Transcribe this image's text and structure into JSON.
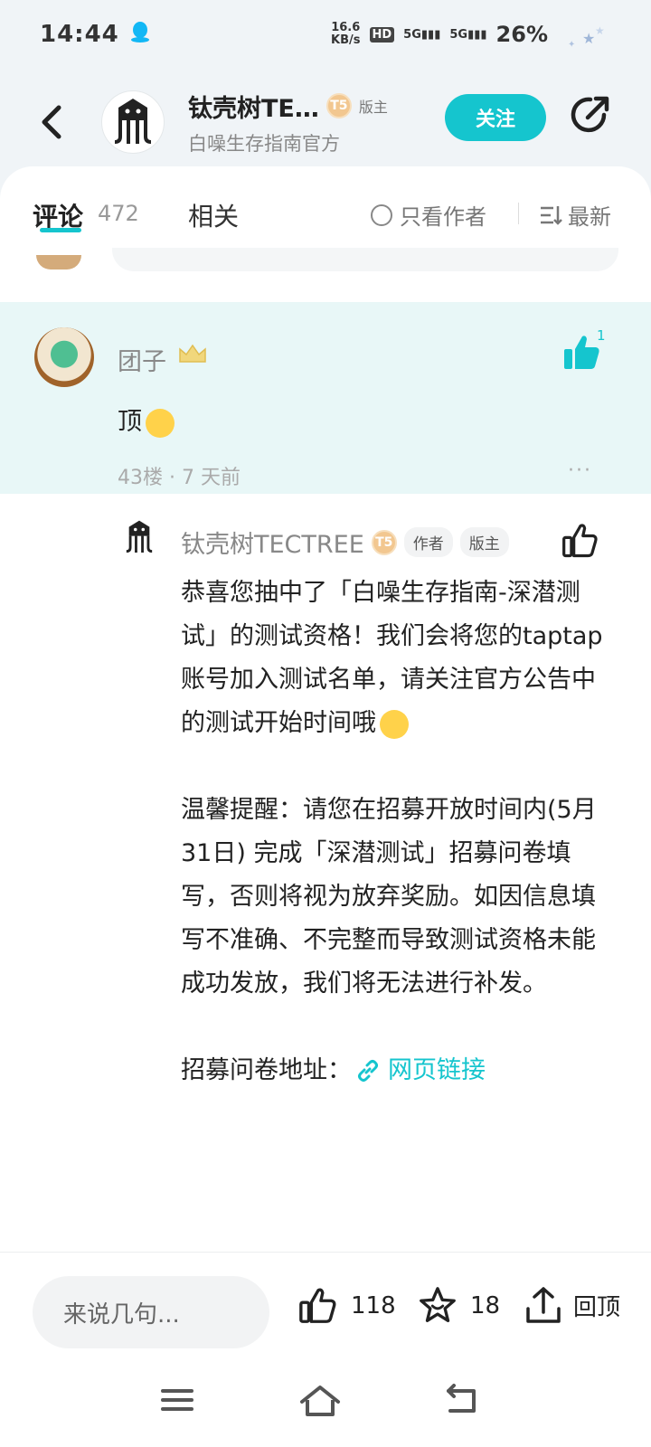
{
  "status_bar": {
    "time": "14:44",
    "speed_value": "16.6",
    "speed_unit": "KB/s",
    "hd_label": "HD",
    "signal1": "5G",
    "signal2": "5G",
    "battery": "26%",
    "icons": [
      "qq-icon",
      "signal-icon",
      "battery-icon"
    ]
  },
  "header": {
    "name": "钛壳树TE…",
    "level": "T5",
    "role": "版主",
    "subtitle": "白噪生存指南官方",
    "follow_label": "关注"
  },
  "tabs": {
    "comments_label": "评论",
    "comments_count": "472",
    "related_label": "相关",
    "author_only_label": "只看作者",
    "sort_label": "最新"
  },
  "comment": {
    "user": "团子",
    "text": "顶",
    "floor": "43楼",
    "time": "7 天前",
    "meta_sep": " · ",
    "like_count": "1",
    "more": "···"
  },
  "reply": {
    "user": "钛壳树TECTREE",
    "level": "T5",
    "tag_author": "作者",
    "tag_role": "版主",
    "para1": "恭喜您抽中了「白噪生存指南-深潜测试」的测试资格！我们会将您的taptap账号加入测试名单，请关注官方公告中的测试开始时间哦",
    "para2": "温馨提醒：请您在招募开放时间内(5月31日) 完成「深潜测试」招募问卷填写，否则将视为放弃奖励。如因信息填写不准确、不完整而导致测试资格未能成功发放，我们将无法进行补发。",
    "link_prefix": "招募问卷地址：",
    "link_label": "网页链接"
  },
  "bottom_bar": {
    "input_placeholder": "来说几句...",
    "like_count": "118",
    "fav_count": "18",
    "top_label": "回顶"
  },
  "colors": {
    "accent": "#15c5ce",
    "highlight_bg": "#e8f7f7"
  }
}
